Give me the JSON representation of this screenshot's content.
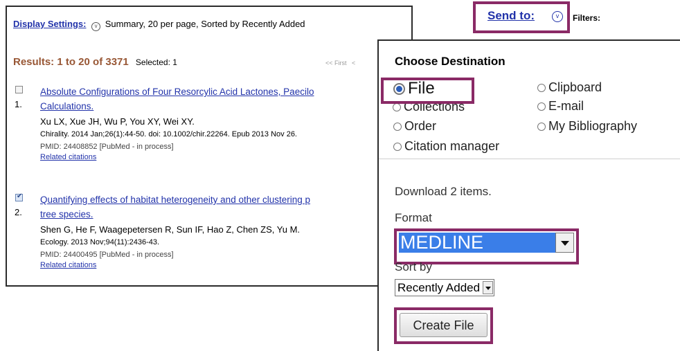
{
  "results": {
    "display_settings_label": "Display Settings:",
    "display_settings_value": "Summary, 20 per page, Sorted by Recently Added",
    "heading": "Results: 1 to 20 of 3371",
    "selected": "Selected: 1",
    "pager_first": "<< First",
    "pager_prev": "<",
    "items": [
      {
        "number": "1.",
        "checked": false,
        "title_line1": "Absolute Configurations of Four Resorcylic Acid Lactones, Paecilo",
        "title_line2": "Calculations.",
        "authors": "Xu LX, Xue JH, Wu P, You XY, Wei XY.",
        "journal": "Chirality. 2014 Jan;26(1):44-50. doi: 10.1002/chir.22264. Epub 2013 Nov 26.",
        "pmid": "PMID: 24408852 [PubMed - in process]",
        "related": "Related citations"
      },
      {
        "number": "2.",
        "checked": true,
        "title_line1": "Quantifying effects of habitat heterogeneity and other clustering p",
        "title_line2": "tree species.",
        "authors": "Shen G, He F, Waagepetersen R, Sun IF, Hao Z, Chen ZS, Yu M.",
        "journal": "Ecology. 2013 Nov;94(11):2436-43.",
        "pmid": "PMID: 24400495 [PubMed - in process]",
        "related": "Related citations"
      }
    ]
  },
  "header": {
    "send_to": "Send to:",
    "filters": "Filters:"
  },
  "destination": {
    "title": "Choose Destination",
    "options": {
      "file": "File",
      "clipboard": "Clipboard",
      "collections": "Collections",
      "email": "E-mail",
      "order": "Order",
      "my_bibliography": "My Bibliography",
      "citation_manager": "Citation manager"
    },
    "selected_option": "File",
    "download_text": "Download 2 items.",
    "format_label": "Format",
    "format_value": "MEDLINE",
    "sort_label": "Sort by",
    "sort_value": "Recently Added",
    "create_button": "Create File"
  },
  "colors": {
    "highlight": "#8a2a66",
    "link": "#2233aa",
    "results_heading": "#985735",
    "select_highlight": "#3a7ee8"
  }
}
